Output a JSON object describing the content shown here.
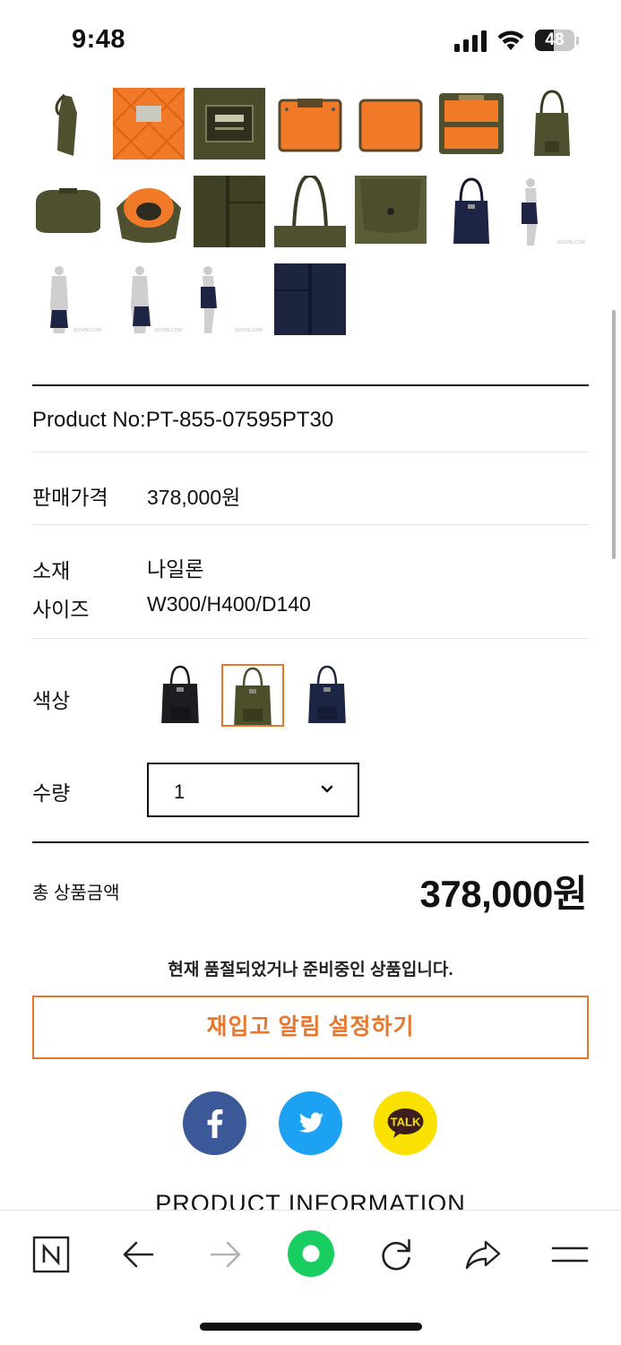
{
  "status_bar": {
    "time": "9:48",
    "battery": "48",
    "battery_level": 0.48
  },
  "gallery": {
    "thumbnails": [
      {
        "name": "bag-side-olive",
        "kind": "bag-side"
      },
      {
        "name": "quilted-orange-lining",
        "kind": "orange-quilt"
      },
      {
        "name": "porter-label-closeup",
        "kind": "label"
      },
      {
        "name": "orange-pouch-1",
        "kind": "orange-pouch"
      },
      {
        "name": "orange-pouch-2",
        "kind": "orange-pouch-plain"
      },
      {
        "name": "olive-pouch-open",
        "kind": "olive-pouch-open"
      },
      {
        "name": "tote-front-olive",
        "kind": "tote-olive"
      },
      {
        "name": "bag-bottom-olive",
        "kind": "bag-bottom"
      },
      {
        "name": "bag-inside-orange",
        "kind": "bag-inside"
      },
      {
        "name": "fabric-closeup-olive",
        "kind": "fabric-olive"
      },
      {
        "name": "bag-handles-olive",
        "kind": "handles"
      },
      {
        "name": "pocket-detail-olive",
        "kind": "pocket"
      },
      {
        "name": "tote-front-navy",
        "kind": "tote-navy"
      },
      {
        "name": "model-side-navy",
        "kind": "model-side"
      },
      {
        "name": "model-front-navy",
        "kind": "model-front"
      },
      {
        "name": "model-back",
        "kind": "model-back"
      },
      {
        "name": "model-side-olive",
        "kind": "model-side-olive"
      },
      {
        "name": "fabric-closeup-navy",
        "kind": "fabric-navy"
      }
    ]
  },
  "product": {
    "product_no": "Product No:PT-855-07595PT30",
    "price_label": "판매가격",
    "price_value": "378,000원",
    "material_label": "소재",
    "material_value": "나일론",
    "size_label": "사이즈",
    "size_value": "W300/H400/D140",
    "color_label": "색상",
    "colors": [
      {
        "name": "black",
        "hex": "#1b1d21",
        "selected": false
      },
      {
        "name": "olive",
        "hex": "#4d4f2b",
        "selected": true
      },
      {
        "name": "navy",
        "hex": "#1c2544",
        "selected": false
      }
    ],
    "qty_label": "수량",
    "qty_value": "1"
  },
  "summary": {
    "total_label": "총 상품금액",
    "total_value": "378,000원",
    "soldout_notice": "현재 품절되었거나 준비중인 상품입니다.",
    "restock_button": "재입고 알림 설정하기"
  },
  "share": [
    {
      "name": "facebook",
      "color": "#3b5998",
      "glyph": "f"
    },
    {
      "name": "twitter",
      "color": "#1da1f2",
      "glyph": "bird"
    },
    {
      "name": "kakaotalk",
      "color": "#fae100",
      "glyph": "TALK"
    }
  ],
  "section_heading": "PRODUCT INFORMATION",
  "toolbar": {
    "items": [
      "naver-home-icon",
      "back-arrow-icon",
      "forward-arrow-icon",
      "green-dot-icon",
      "reload-icon",
      "share-icon",
      "menu-icon"
    ],
    "accent": "#19ce60"
  },
  "colors": {
    "accent_orange": "#e8772e"
  }
}
